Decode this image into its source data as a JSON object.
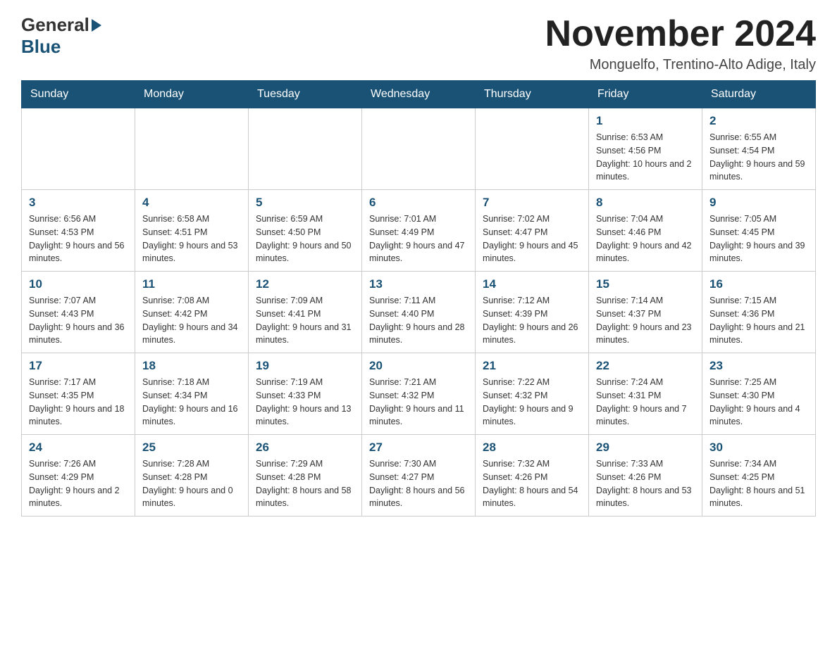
{
  "header": {
    "logo_general": "General",
    "logo_blue": "Blue",
    "month_title": "November 2024",
    "location": "Monguelfo, Trentino-Alto Adige, Italy"
  },
  "weekdays": [
    "Sunday",
    "Monday",
    "Tuesday",
    "Wednesday",
    "Thursday",
    "Friday",
    "Saturday"
  ],
  "weeks": [
    [
      {
        "day": "",
        "sunrise": "",
        "sunset": "",
        "daylight": ""
      },
      {
        "day": "",
        "sunrise": "",
        "sunset": "",
        "daylight": ""
      },
      {
        "day": "",
        "sunrise": "",
        "sunset": "",
        "daylight": ""
      },
      {
        "day": "",
        "sunrise": "",
        "sunset": "",
        "daylight": ""
      },
      {
        "day": "",
        "sunrise": "",
        "sunset": "",
        "daylight": ""
      },
      {
        "day": "1",
        "sunrise": "Sunrise: 6:53 AM",
        "sunset": "Sunset: 4:56 PM",
        "daylight": "Daylight: 10 hours and 2 minutes."
      },
      {
        "day": "2",
        "sunrise": "Sunrise: 6:55 AM",
        "sunset": "Sunset: 4:54 PM",
        "daylight": "Daylight: 9 hours and 59 minutes."
      }
    ],
    [
      {
        "day": "3",
        "sunrise": "Sunrise: 6:56 AM",
        "sunset": "Sunset: 4:53 PM",
        "daylight": "Daylight: 9 hours and 56 minutes."
      },
      {
        "day": "4",
        "sunrise": "Sunrise: 6:58 AM",
        "sunset": "Sunset: 4:51 PM",
        "daylight": "Daylight: 9 hours and 53 minutes."
      },
      {
        "day": "5",
        "sunrise": "Sunrise: 6:59 AM",
        "sunset": "Sunset: 4:50 PM",
        "daylight": "Daylight: 9 hours and 50 minutes."
      },
      {
        "day": "6",
        "sunrise": "Sunrise: 7:01 AM",
        "sunset": "Sunset: 4:49 PM",
        "daylight": "Daylight: 9 hours and 47 minutes."
      },
      {
        "day": "7",
        "sunrise": "Sunrise: 7:02 AM",
        "sunset": "Sunset: 4:47 PM",
        "daylight": "Daylight: 9 hours and 45 minutes."
      },
      {
        "day": "8",
        "sunrise": "Sunrise: 7:04 AM",
        "sunset": "Sunset: 4:46 PM",
        "daylight": "Daylight: 9 hours and 42 minutes."
      },
      {
        "day": "9",
        "sunrise": "Sunrise: 7:05 AM",
        "sunset": "Sunset: 4:45 PM",
        "daylight": "Daylight: 9 hours and 39 minutes."
      }
    ],
    [
      {
        "day": "10",
        "sunrise": "Sunrise: 7:07 AM",
        "sunset": "Sunset: 4:43 PM",
        "daylight": "Daylight: 9 hours and 36 minutes."
      },
      {
        "day": "11",
        "sunrise": "Sunrise: 7:08 AM",
        "sunset": "Sunset: 4:42 PM",
        "daylight": "Daylight: 9 hours and 34 minutes."
      },
      {
        "day": "12",
        "sunrise": "Sunrise: 7:09 AM",
        "sunset": "Sunset: 4:41 PM",
        "daylight": "Daylight: 9 hours and 31 minutes."
      },
      {
        "day": "13",
        "sunrise": "Sunrise: 7:11 AM",
        "sunset": "Sunset: 4:40 PM",
        "daylight": "Daylight: 9 hours and 28 minutes."
      },
      {
        "day": "14",
        "sunrise": "Sunrise: 7:12 AM",
        "sunset": "Sunset: 4:39 PM",
        "daylight": "Daylight: 9 hours and 26 minutes."
      },
      {
        "day": "15",
        "sunrise": "Sunrise: 7:14 AM",
        "sunset": "Sunset: 4:37 PM",
        "daylight": "Daylight: 9 hours and 23 minutes."
      },
      {
        "day": "16",
        "sunrise": "Sunrise: 7:15 AM",
        "sunset": "Sunset: 4:36 PM",
        "daylight": "Daylight: 9 hours and 21 minutes."
      }
    ],
    [
      {
        "day": "17",
        "sunrise": "Sunrise: 7:17 AM",
        "sunset": "Sunset: 4:35 PM",
        "daylight": "Daylight: 9 hours and 18 minutes."
      },
      {
        "day": "18",
        "sunrise": "Sunrise: 7:18 AM",
        "sunset": "Sunset: 4:34 PM",
        "daylight": "Daylight: 9 hours and 16 minutes."
      },
      {
        "day": "19",
        "sunrise": "Sunrise: 7:19 AM",
        "sunset": "Sunset: 4:33 PM",
        "daylight": "Daylight: 9 hours and 13 minutes."
      },
      {
        "day": "20",
        "sunrise": "Sunrise: 7:21 AM",
        "sunset": "Sunset: 4:32 PM",
        "daylight": "Daylight: 9 hours and 11 minutes."
      },
      {
        "day": "21",
        "sunrise": "Sunrise: 7:22 AM",
        "sunset": "Sunset: 4:32 PM",
        "daylight": "Daylight: 9 hours and 9 minutes."
      },
      {
        "day": "22",
        "sunrise": "Sunrise: 7:24 AM",
        "sunset": "Sunset: 4:31 PM",
        "daylight": "Daylight: 9 hours and 7 minutes."
      },
      {
        "day": "23",
        "sunrise": "Sunrise: 7:25 AM",
        "sunset": "Sunset: 4:30 PM",
        "daylight": "Daylight: 9 hours and 4 minutes."
      }
    ],
    [
      {
        "day": "24",
        "sunrise": "Sunrise: 7:26 AM",
        "sunset": "Sunset: 4:29 PM",
        "daylight": "Daylight: 9 hours and 2 minutes."
      },
      {
        "day": "25",
        "sunrise": "Sunrise: 7:28 AM",
        "sunset": "Sunset: 4:28 PM",
        "daylight": "Daylight: 9 hours and 0 minutes."
      },
      {
        "day": "26",
        "sunrise": "Sunrise: 7:29 AM",
        "sunset": "Sunset: 4:28 PM",
        "daylight": "Daylight: 8 hours and 58 minutes."
      },
      {
        "day": "27",
        "sunrise": "Sunrise: 7:30 AM",
        "sunset": "Sunset: 4:27 PM",
        "daylight": "Daylight: 8 hours and 56 minutes."
      },
      {
        "day": "28",
        "sunrise": "Sunrise: 7:32 AM",
        "sunset": "Sunset: 4:26 PM",
        "daylight": "Daylight: 8 hours and 54 minutes."
      },
      {
        "day": "29",
        "sunrise": "Sunrise: 7:33 AM",
        "sunset": "Sunset: 4:26 PM",
        "daylight": "Daylight: 8 hours and 53 minutes."
      },
      {
        "day": "30",
        "sunrise": "Sunrise: 7:34 AM",
        "sunset": "Sunset: 4:25 PM",
        "daylight": "Daylight: 8 hours and 51 minutes."
      }
    ]
  ]
}
